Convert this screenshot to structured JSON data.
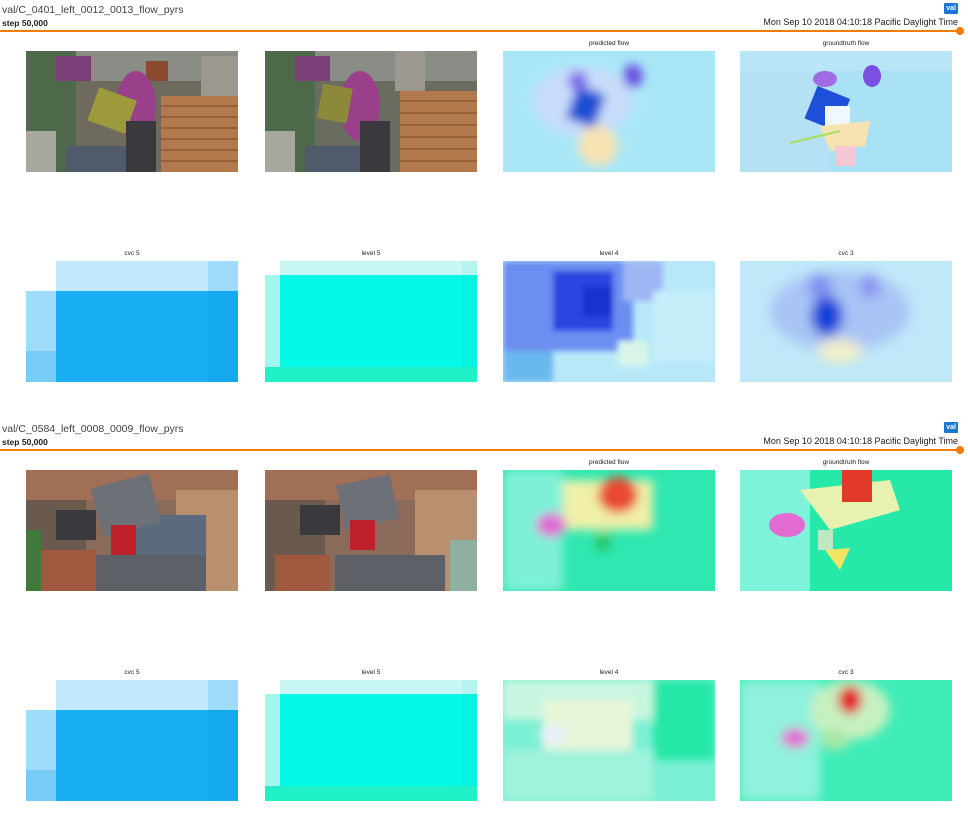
{
  "panels": [
    {
      "tag": "val/C_0401_left_0012_0013_flow_pyrs",
      "step": "step 50,000",
      "run_badge": "val",
      "timestamp": "Mon Sep 10 2018 04:10:18 Pacific Daylight Time",
      "captions": [
        "",
        "",
        "predicted flow",
        "groundtruth flow",
        "cvc 5",
        "level 5",
        "level 4",
        "cvc 3"
      ]
    },
    {
      "tag": "val/C_0584_left_0008_0009_flow_pyrs",
      "step": "step 50,000",
      "run_badge": "val",
      "timestamp": "Mon Sep 10 2018 04:10:18 Pacific Daylight Time",
      "captions": [
        "",
        "",
        "predicted flow",
        "groundtruth flow",
        "cvc 5",
        "level 5",
        "level 4",
        "cvc 3"
      ]
    }
  ],
  "colors": {
    "accent": "#f57c00",
    "badge": "#1976d2"
  }
}
